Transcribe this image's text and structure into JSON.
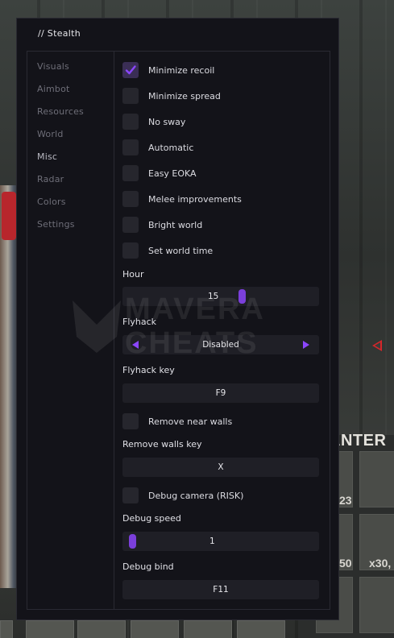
{
  "menu": {
    "title": "// Stealth",
    "sidebar": [
      {
        "label": "Visuals",
        "active": false
      },
      {
        "label": "Aimbot",
        "active": false
      },
      {
        "label": "Resources",
        "active": false
      },
      {
        "label": "World",
        "active": false
      },
      {
        "label": "Misc",
        "active": true
      },
      {
        "label": "Radar",
        "active": false
      },
      {
        "label": "Colors",
        "active": false
      },
      {
        "label": "Settings",
        "active": false
      }
    ],
    "toggles": [
      {
        "label": "Minimize recoil",
        "checked": true
      },
      {
        "label": "Minimize spread",
        "checked": false
      },
      {
        "label": "No sway",
        "checked": false
      },
      {
        "label": "Automatic",
        "checked": false
      },
      {
        "label": "Easy EOKA",
        "checked": false
      },
      {
        "label": "Melee improvements",
        "checked": false
      },
      {
        "label": "Bright world",
        "checked": false
      },
      {
        "label": "Set world time",
        "checked": false
      }
    ],
    "hour": {
      "label": "Hour",
      "value": "15",
      "level": 0.62
    },
    "flyhack": {
      "label": "Flyhack",
      "value": "Disabled"
    },
    "flyhack_key": {
      "label": "Flyhack key",
      "value": "F9"
    },
    "remove_near_walls": {
      "label": "Remove near walls",
      "checked": false
    },
    "remove_walls_key": {
      "label": "Remove walls key",
      "value": "X"
    },
    "debug_camera": {
      "label": "Debug camera (RISK)",
      "checked": false
    },
    "debug_speed": {
      "label": "Debug speed",
      "value": "1",
      "level": 0.0
    },
    "debug_bind": {
      "label": "Debug bind",
      "value": "F11"
    }
  },
  "game": {
    "crafter_label": "ANTER",
    "slot_counts": [
      "23",
      "50",
      "x30,"
    ],
    "watermark": [
      "MAVERA",
      "CHEATS"
    ]
  },
  "colors": {
    "accent": "#7b3fdb",
    "arrow": "#8b46ff",
    "panel": "#131319",
    "control": "#1f1f26"
  }
}
